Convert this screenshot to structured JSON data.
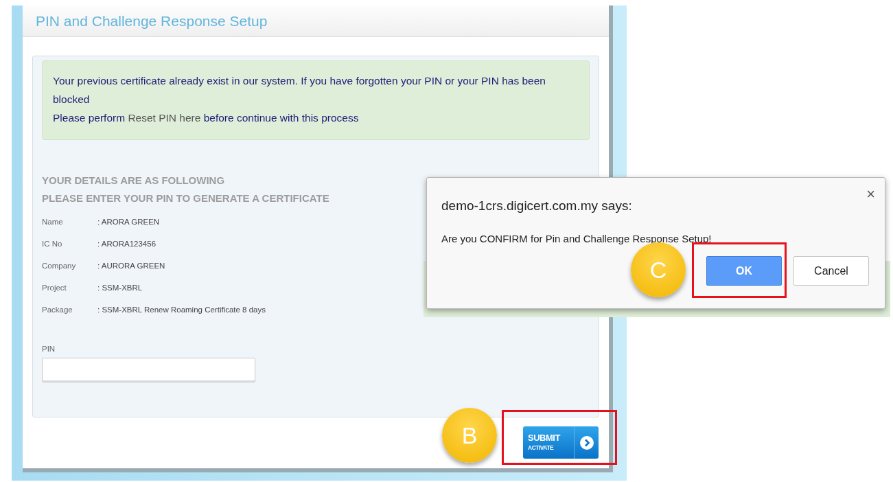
{
  "page": {
    "title": "PIN and Challenge Response Setup"
  },
  "alert": {
    "message": "Your previous certificate already exist in our system. If you have forgotten your PIN or your PIN has been blocked",
    "instruction_before": "Please perform ",
    "link": "Reset PIN here",
    "instruction_after": " before continue with this process"
  },
  "details": {
    "headings": [
      "YOUR DETAILS ARE AS FOLLOWING",
      "PLEASE ENTER YOUR PIN TO GENERATE A CERTIFICATE"
    ],
    "rows": [
      {
        "label": "Name",
        "value": ": ARORA GREEN"
      },
      {
        "label": "IC No",
        "value": ": ARORA123456"
      },
      {
        "label": "Company",
        "value": ": AURORA GREEN"
      },
      {
        "label": "Project",
        "value": ": SSM-XBRL"
      },
      {
        "label": "Package",
        "value": ": SSM-XBRL Renew Roaming Certificate 8 days"
      }
    ]
  },
  "pin_field": {
    "label": "PIN"
  },
  "submit_button": {
    "label": "SUBMIT",
    "sublabel": "ACTIVATE"
  },
  "dialog": {
    "title": "demo-1crs.digicert.com.my says:",
    "message": "Are you CONFIRM for Pin and Challenge Response Setup!",
    "close": "×",
    "buttons": [
      "OK",
      "Cancel"
    ]
  },
  "annotations": [
    {
      "label": "B"
    },
    {
      "label": "C"
    }
  ]
}
